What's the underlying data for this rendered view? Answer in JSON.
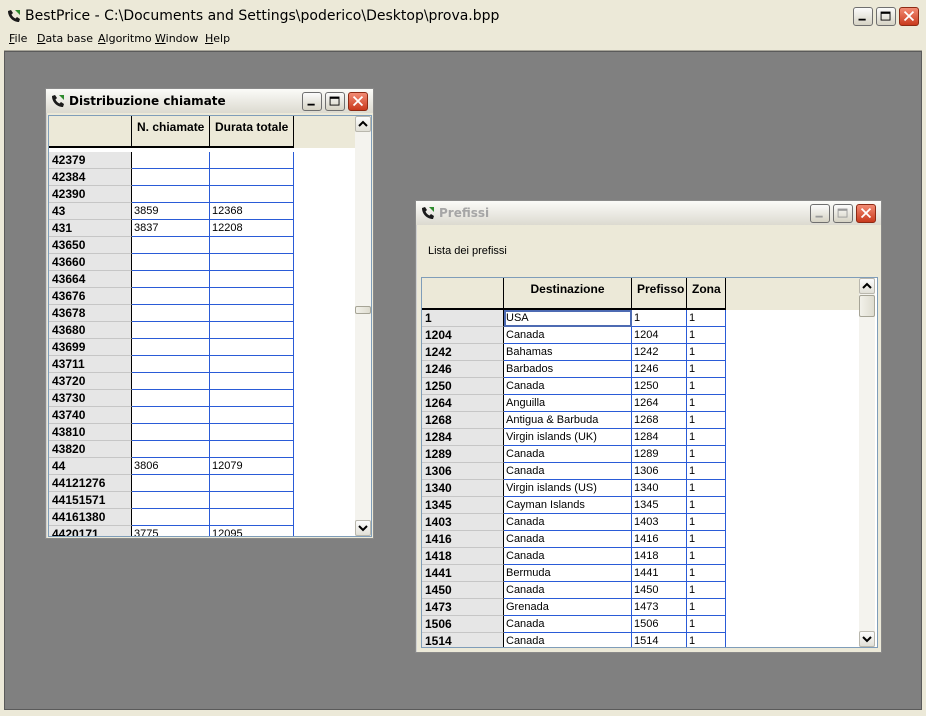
{
  "app": {
    "title": "BestPrice - C:\\Documents and Settings\\poderico\\Desktop\\prova.bpp",
    "menu": [
      {
        "key": "F",
        "rest": "ile"
      },
      {
        "key": "D",
        "rest": "ata base"
      },
      {
        "key": "A",
        "rest": "lgoritmo"
      },
      {
        "key": "W",
        "rest": "indow"
      },
      {
        "key": "H",
        "rest": "elp"
      }
    ]
  },
  "distribuzione": {
    "title": "Distribuzione chiamate",
    "columns": [
      "N. chiamate",
      "Durata totale"
    ],
    "rows": [
      {
        "id": "42379",
        "n": "",
        "d": ""
      },
      {
        "id": "42384",
        "n": "",
        "d": ""
      },
      {
        "id": "42390",
        "n": "",
        "d": ""
      },
      {
        "id": "43",
        "n": "3859",
        "d": "12368"
      },
      {
        "id": "431",
        "n": "3837",
        "d": "12208"
      },
      {
        "id": "43650",
        "n": "",
        "d": ""
      },
      {
        "id": "43660",
        "n": "",
        "d": ""
      },
      {
        "id": "43664",
        "n": "",
        "d": ""
      },
      {
        "id": "43676",
        "n": "",
        "d": ""
      },
      {
        "id": "43678",
        "n": "",
        "d": ""
      },
      {
        "id": "43680",
        "n": "",
        "d": ""
      },
      {
        "id": "43699",
        "n": "",
        "d": ""
      },
      {
        "id": "43711",
        "n": "",
        "d": ""
      },
      {
        "id": "43720",
        "n": "",
        "d": ""
      },
      {
        "id": "43730",
        "n": "",
        "d": ""
      },
      {
        "id": "43740",
        "n": "",
        "d": ""
      },
      {
        "id": "43810",
        "n": "",
        "d": ""
      },
      {
        "id": "43820",
        "n": "",
        "d": ""
      },
      {
        "id": "44",
        "n": "3806",
        "d": "12079"
      },
      {
        "id": "44121276",
        "n": "",
        "d": ""
      },
      {
        "id": "44151571",
        "n": "",
        "d": ""
      },
      {
        "id": "44161380",
        "n": "",
        "d": ""
      },
      {
        "id": "4420171",
        "n": "3775",
        "d": "12095"
      }
    ]
  },
  "prefissi": {
    "title": "Prefissi",
    "subtitle": "Lista dei prefissi",
    "columns": [
      "Destinazione",
      "Prefisso",
      "Zona"
    ],
    "rows": [
      {
        "id": "1",
        "dest": "USA",
        "pref": "1",
        "zona": "1"
      },
      {
        "id": "1204",
        "dest": "Canada",
        "pref": "1204",
        "zona": "1"
      },
      {
        "id": "1242",
        "dest": "Bahamas",
        "pref": "1242",
        "zona": "1"
      },
      {
        "id": "1246",
        "dest": "Barbados",
        "pref": "1246",
        "zona": "1"
      },
      {
        "id": "1250",
        "dest": "Canada",
        "pref": "1250",
        "zona": "1"
      },
      {
        "id": "1264",
        "dest": "Anguilla",
        "pref": "1264",
        "zona": "1"
      },
      {
        "id": "1268",
        "dest": "Antigua & Barbuda",
        "pref": "1268",
        "zona": "1"
      },
      {
        "id": "1284",
        "dest": "Virgin islands (UK)",
        "pref": "1284",
        "zona": "1"
      },
      {
        "id": "1289",
        "dest": "Canada",
        "pref": "1289",
        "zona": "1"
      },
      {
        "id": "1306",
        "dest": "Canada",
        "pref": "1306",
        "zona": "1"
      },
      {
        "id": "1340",
        "dest": "Virgin islands (US)",
        "pref": "1340",
        "zona": "1"
      },
      {
        "id": "1345",
        "dest": "Cayman Islands",
        "pref": "1345",
        "zona": "1"
      },
      {
        "id": "1403",
        "dest": "Canada",
        "pref": "1403",
        "zona": "1"
      },
      {
        "id": "1416",
        "dest": "Canada",
        "pref": "1416",
        "zona": "1"
      },
      {
        "id": "1418",
        "dest": "Canada",
        "pref": "1418",
        "zona": "1"
      },
      {
        "id": "1441",
        "dest": "Bermuda",
        "pref": "1441",
        "zona": "1"
      },
      {
        "id": "1450",
        "dest": "Canada",
        "pref": "1450",
        "zona": "1"
      },
      {
        "id": "1473",
        "dest": "Grenada",
        "pref": "1473",
        "zona": "1"
      },
      {
        "id": "1506",
        "dest": "Canada",
        "pref": "1506",
        "zona": "1"
      },
      {
        "id": "1514",
        "dest": "Canada",
        "pref": "1514",
        "zona": "1"
      }
    ]
  },
  "colors": {
    "mdi_background": "#808080",
    "grid_line": "#2a5bd7",
    "close_button": "#c93a1d"
  }
}
